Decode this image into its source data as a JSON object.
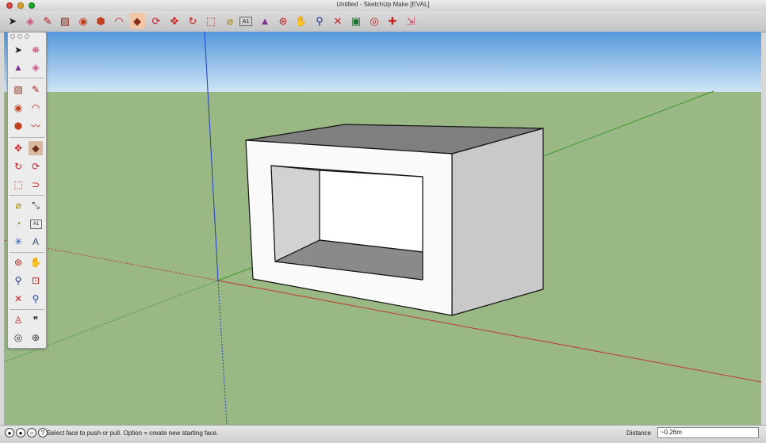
{
  "window": {
    "title": "Untitled - SketchUp Make [EVAL]"
  },
  "toolbar": {
    "icons": [
      "select-icon",
      "eraser-icon",
      "pencil-icon",
      "rectangle-icon",
      "circle-icon",
      "polygon-icon",
      "arc-icon",
      "push-pull-icon",
      "follow-me-icon",
      "move-icon",
      "rotate-icon",
      "scale-icon",
      "tape-measure-icon",
      "text-icon",
      "paint-bucket-icon",
      "orbit-icon",
      "pan-icon",
      "zoom-icon",
      "zoom-extents-icon",
      "position-camera-icon",
      "look-around-icon",
      "section-plane-icon",
      "dimension-icon"
    ],
    "text_icon_label": "A1"
  },
  "palette": {
    "text_icon_label": "A1"
  },
  "status": {
    "message": "Select face to push or pull.  Option = create new starting face.",
    "distance_label": "Distance",
    "distance_value": "~0.26m"
  },
  "colors": {
    "sky": "#5aa0e0",
    "ground": "#9ab883",
    "red_axis": "#c0392b",
    "green_axis": "#3c9a30",
    "blue_axis": "#1f3fbf"
  }
}
